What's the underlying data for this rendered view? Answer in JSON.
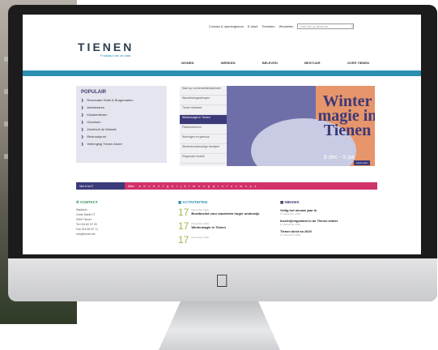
{
  "site": {
    "topnav": [
      "Contact & openingsuren",
      "E-loket",
      "Toeristen",
      "Wonkelen"
    ],
    "search_placeholder": "Zoek hier op tienen.be",
    "logo_text": "TIENEN",
    "tagline": "Fruitstad van de stad",
    "mainnav": [
      "WONEN",
      "WERKEN",
      "BELEVEN",
      "BESTUUR",
      "OVER TIENEN"
    ],
    "popular": {
      "title": "POPULAIR",
      "items": [
        "Reservatie Hotel & Burgerzaken",
        "Ambtenaren",
        "Kluisbedienen",
        "Gezelnen",
        "Zwerfvuil de Wissels",
        "Reisrookpunt",
        "Verlenging Tienen Ander"
      ]
    },
    "midlist": [
      "Start op evenementenkalender",
      "Wandelvergaderingen",
      "Tienen Netwerk",
      "Wintermagie in Tienen",
      "Parkeerbrieven",
      "Woningen en gebouw",
      "Stedenbouwkundige bewijzen",
      "Regionaal muziek"
    ],
    "banner": {
      "title": "Winter magie in Tienen",
      "sub": "6 dec - 5 jan",
      "button": "Lees meer"
    },
    "az": {
      "label": "Van A tot Z",
      "tag": "Alles",
      "letters": [
        "a",
        "b",
        "c",
        "d",
        "e",
        "f",
        "g",
        "h",
        "i",
        "j",
        "k",
        "l",
        "m",
        "n",
        "o",
        "p",
        "q",
        "r",
        "s",
        "t",
        "u",
        "v",
        "w",
        "x",
        "y",
        "z"
      ]
    },
    "contact": {
      "title": "CONTACT",
      "lines": [
        "Stadhuis",
        "Grote Markt 27",
        "3300 Tienen",
        "Tel 016 80 57 00",
        "Fax 016 80 57 71",
        "info@tienen.be"
      ]
    },
    "activities": {
      "title": "ACTIVITEITEN",
      "items": [
        {
          "num": "17",
          "date": "December 2019",
          "text": "Bordbeslist voor studenten hoger onderwijs"
        },
        {
          "num": "17",
          "date": "December 2019",
          "text": "Wintermagie in Tienen"
        },
        {
          "num": "17",
          "date": "December 2019",
          "text": ""
        }
      ]
    },
    "news": {
      "title": "NIEUWS",
      "items": [
        {
          "text": "Veilig het nieuwe jaar in",
          "date": "17 december 2019"
        },
        {
          "text": "Inschrijvingsloket in de Tienen winter",
          "date": "17 december 2019"
        },
        {
          "text": "Tienen kiest na 2020",
          "date": "17 december 2019"
        }
      ]
    }
  }
}
